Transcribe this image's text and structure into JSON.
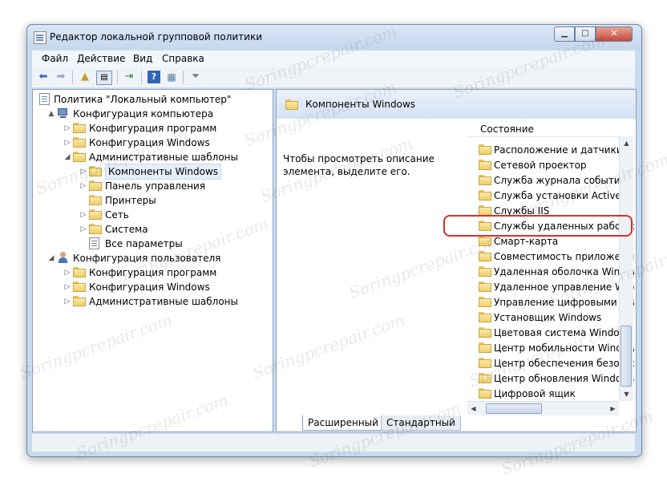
{
  "window": {
    "title": "Редактор локальной групповой политики"
  },
  "menu": [
    {
      "label": "Файл",
      "accel": "Ф"
    },
    {
      "label": "Действие",
      "accel": "Д"
    },
    {
      "label": "Вид",
      "accel": "В"
    },
    {
      "label": "Справка",
      "accel": "С"
    }
  ],
  "toolbar": {
    "buttons": [
      "back-icon",
      "forward-icon",
      "up-folder-icon",
      "show-hide-tree-icon",
      "export-list-icon",
      "help-icon",
      "properties-icon",
      "filter-icon"
    ]
  },
  "tree": [
    {
      "label": "Политика \"Локальный компьютер\"",
      "icon": "policy-icon",
      "level": 0,
      "arrow": ""
    },
    {
      "label": "Конфигурация компьютера",
      "icon": "computer-icon",
      "level": 1,
      "arrow": "▲"
    },
    {
      "label": "Конфигурация программ",
      "icon": "folder-icon",
      "level": 2,
      "arrow": "▷"
    },
    {
      "label": "Конфигурация Windows",
      "icon": "folder-icon",
      "level": 2,
      "arrow": "▷"
    },
    {
      "label": "Административные шаблоны",
      "icon": "folder-icon",
      "level": 2,
      "arrow": "◢"
    },
    {
      "label": "Компоненты Windows",
      "icon": "folder-icon",
      "level": 3,
      "arrow": "▷",
      "selected": true
    },
    {
      "label": "Панель управления",
      "icon": "folder-icon",
      "level": 3,
      "arrow": "▷"
    },
    {
      "label": "Принтеры",
      "icon": "folder-icon",
      "level": 3,
      "arrow": ""
    },
    {
      "label": "Сеть",
      "icon": "folder-icon",
      "level": 3,
      "arrow": "▷"
    },
    {
      "label": "Система",
      "icon": "folder-icon",
      "level": 3,
      "arrow": "▷"
    },
    {
      "label": "Все параметры",
      "icon": "settings-doc-icon",
      "level": 3,
      "arrow": ""
    },
    {
      "label": "Конфигурация пользователя",
      "icon": "user-icon",
      "level": 1,
      "arrow": "◢"
    },
    {
      "label": "Конфигурация программ",
      "icon": "folder-icon",
      "level": 2,
      "arrow": "▷"
    },
    {
      "label": "Конфигурация Windows",
      "icon": "folder-icon",
      "level": 2,
      "arrow": "▷"
    },
    {
      "label": "Административные шаблоны",
      "icon": "folder-icon",
      "level": 2,
      "arrow": "▷"
    }
  ],
  "details": {
    "header": "Компоненты Windows",
    "description": "Чтобы просмотреть описание элемента, выделите его.",
    "column": "Состояние",
    "items": [
      "Расположение и датчики",
      "Сетевой проектор",
      "Служба журнала событий",
      "Служба установки ActiveX",
      "Службы IIS",
      "Службы удаленных рабочих столов",
      "Смарт-карта",
      "Совместимость приложений",
      "Удаленная оболочка Windows",
      "Удаленное управление Windows",
      "Управление цифровыми правами Windows",
      "Установщик Windows",
      "Цветовая система Windows Color System",
      "Центр мобильности Windows",
      "Центр обеспечения безопасности",
      "Центр обновления Windows",
      "Цифровой ящик"
    ],
    "highlighted_index": 5
  },
  "tabs": [
    {
      "label": "Расширенный",
      "active": true
    },
    {
      "label": "Стандартный",
      "active": false
    }
  ],
  "watermark": "Soringpcrepair.com",
  "colors": {
    "highlight": "#d9302a",
    "window_frame": "#c9dbef"
  }
}
